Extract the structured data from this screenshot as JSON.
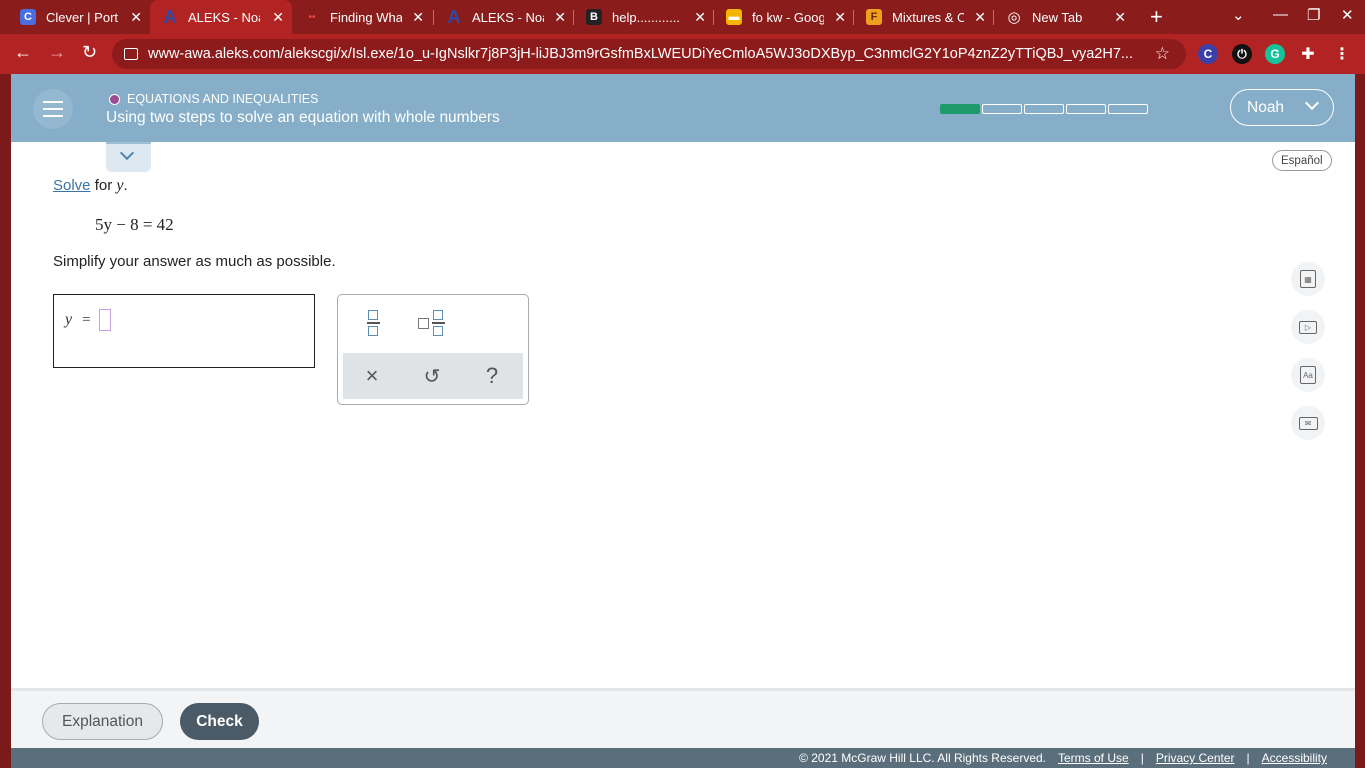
{
  "browser": {
    "tabs": [
      {
        "title": "Clever | Porta",
        "icon": "C",
        "icon_bg": "#4a6ee0"
      },
      {
        "title": "ALEKS - Noa",
        "icon": "A",
        "icon_bg": "#2c4aa8"
      },
      {
        "title": "Finding What",
        "icon": "••",
        "icon_bg": "#444"
      },
      {
        "title": "ALEKS - Noa",
        "icon": "A",
        "icon_bg": "#2c4aa8"
      },
      {
        "title": "help............",
        "icon": "B",
        "icon_bg": "#222"
      },
      {
        "title": "fo kw - Googl",
        "icon": "▬",
        "icon_bg": "#f4b400"
      },
      {
        "title": "Mixtures & C",
        "icon": "F",
        "icon_bg": "#f0a020"
      },
      {
        "title": "New Tab",
        "icon": "◎",
        "icon_bg": "#777"
      }
    ],
    "active_tab": 1,
    "url": "www-awa.aleks.com/alekscgi/x/Isl.exe/1o_u-IgNslkr7j8P3jH-liJBJ3m9rGsfmBxLWEUDiYeCmloA5WJ3oDXByp_C3nmclG2Y1oP4znZ2yTTiQBJ_vya2H7...",
    "colors": {
      "frame": "#8a1c1c",
      "toolbar": "#b22424"
    }
  },
  "header": {
    "category": "EQUATIONS AND INEQUALITIES",
    "title": "Using two steps to solve an equation with whole numbers",
    "progress": {
      "filled": 1,
      "total": 5
    },
    "user": "Noah",
    "language_button": "Español"
  },
  "problem": {
    "solve_link": "Solve",
    "for_text": "for",
    "variable": "y",
    "period": ".",
    "equation": "5y − 8 = 42",
    "instruction": "Simplify your answer as much as possible.",
    "answer_var": "y",
    "answer_eq": "=",
    "answer_value": ""
  },
  "keypad": {
    "fraction": "fraction-icon",
    "mixed_number": "mixed-number-icon",
    "clear": "×",
    "undo": "↺",
    "help": "?"
  },
  "side_tools": [
    "calculator-icon",
    "video-icon",
    "dictionary-icon",
    "mail-icon"
  ],
  "actions": {
    "explanation": "Explanation",
    "check": "Check"
  },
  "footer": {
    "copyright": "© 2021 McGraw Hill LLC. All Rights Reserved.",
    "terms": "Terms of Use",
    "privacy": "Privacy Center",
    "accessibility": "Accessibility"
  }
}
